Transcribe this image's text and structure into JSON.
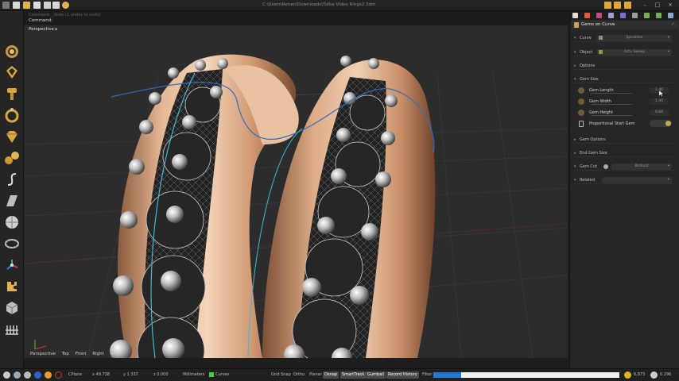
{
  "window": {
    "title": "C:\\Users\\Renan\\Downloads\\Tutka Video Rings2.3dm"
  },
  "command": {
    "hint": "Command: _Undo (1 undos to undo)",
    "label": "Command:"
  },
  "left_toolbar": {
    "icons": [
      "ring-gem-icon",
      "prong-icon",
      "head-icon",
      "ring-icon",
      "diamond-icon",
      "gems-icon",
      "curve-icon",
      "cutter-icon",
      "sphere-icon",
      "band-icon",
      "gumball-icon",
      "puzzle-icon",
      "cube-icon",
      "grid-icon"
    ]
  },
  "viewport": {
    "label": "Perspective",
    "tabs": [
      "Perspective",
      "Top",
      "Front",
      "Right"
    ]
  },
  "panel": {
    "title": "Gems on Curve",
    "rows": {
      "curve": {
        "label": "Curve",
        "value": "Spiralline"
      },
      "object": {
        "label": "Object",
        "value": "Actu Sweep"
      },
      "options": {
        "label": "Options"
      },
      "gem_size": {
        "label": "Gem Size"
      },
      "gem_options": {
        "label": "Gem Options"
      },
      "end_gem_size": {
        "label": "End Gem Size"
      },
      "gem_cut": {
        "label": "Gem Cut",
        "value": "Brilliant"
      },
      "related": {
        "label": "Related"
      }
    },
    "sliders": {
      "gem_length": {
        "label": "Gem Length",
        "value": "1.40"
      },
      "gem_width": {
        "label": "Gem Width",
        "value": "1.40"
      },
      "gem_height": {
        "label": "Gem Height",
        "value": "0.84"
      }
    },
    "proportional": {
      "label": "Proportional Start Gem",
      "enabled": true
    }
  },
  "status": {
    "cplane": "CPlane",
    "x": "x 49.738",
    "y": "y 1.337",
    "z": "z 0.000",
    "units": "Millimeters",
    "layer": "Curves",
    "toggles": [
      {
        "label": "Grid Snap",
        "on": false
      },
      {
        "label": "Ortho",
        "on": false
      },
      {
        "label": "Planar",
        "on": false
      },
      {
        "label": "Osnap",
        "on": true
      },
      {
        "label": "SmartTrack",
        "on": true
      },
      {
        "label": "Gumball",
        "on": true
      },
      {
        "label": "Record History",
        "on": true
      },
      {
        "label": "Filter",
        "on": false
      }
    ],
    "progress": 0.15,
    "count": "6,873",
    "fps": "0.296"
  },
  "colors": {
    "metal": "#d9a583",
    "accent_blue": "#1f78d1",
    "gold": "#c6a657"
  }
}
